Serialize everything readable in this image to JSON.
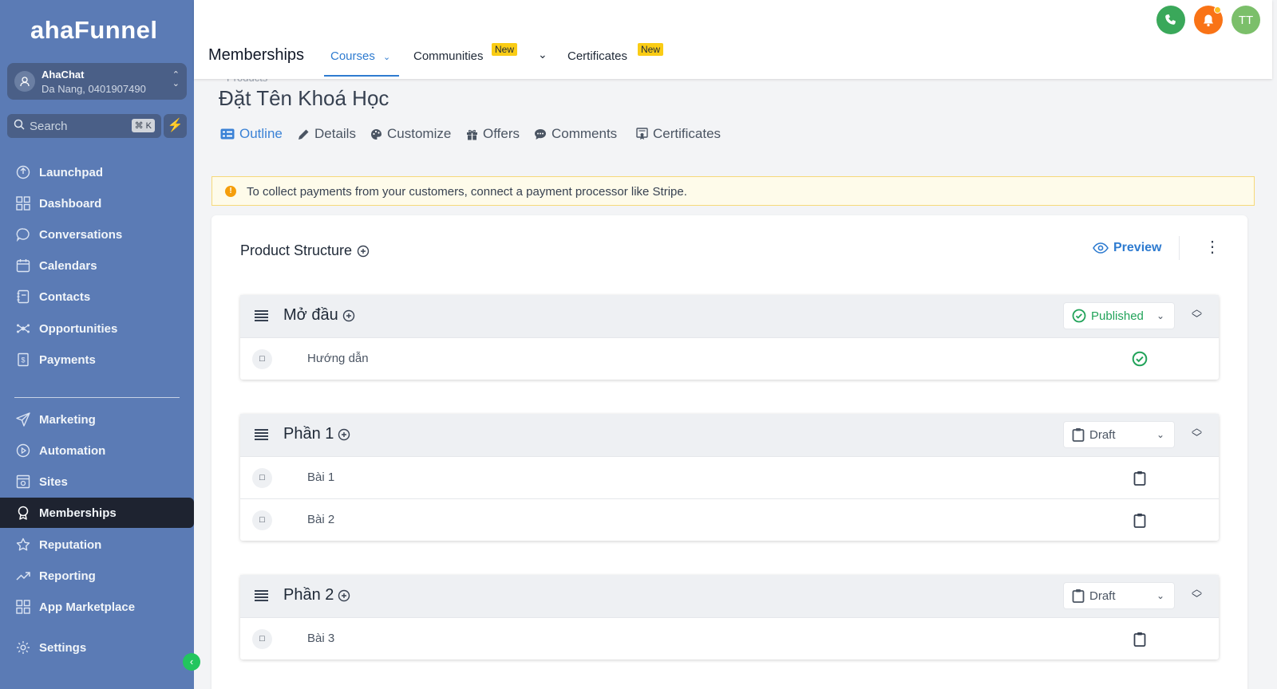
{
  "brand": {
    "logo": "ahaFunnel"
  },
  "account": {
    "name": "AhaChat",
    "location": "Da Nang, 0401907490"
  },
  "search": {
    "placeholder": "Search",
    "shortcut": "⌘ K"
  },
  "sidebar": {
    "items": [
      {
        "label": "Launchpad",
        "icon": "launchpad-icon"
      },
      {
        "label": "Dashboard",
        "icon": "dashboard-icon"
      },
      {
        "label": "Conversations",
        "icon": "chat-icon"
      },
      {
        "label": "Calendars",
        "icon": "calendar-icon"
      },
      {
        "label": "Contacts",
        "icon": "contacts-icon"
      },
      {
        "label": "Opportunities",
        "icon": "opportunities-icon"
      },
      {
        "label": "Payments",
        "icon": "payments-icon"
      },
      {
        "label": "Marketing",
        "icon": "send-icon"
      },
      {
        "label": "Automation",
        "icon": "automation-icon"
      },
      {
        "label": "Sites",
        "icon": "sites-icon"
      },
      {
        "label": "Memberships",
        "icon": "award-icon",
        "active": true
      },
      {
        "label": "Reputation",
        "icon": "star-icon"
      },
      {
        "label": "Reporting",
        "icon": "trend-icon"
      },
      {
        "label": "App Marketplace",
        "icon": "apps-icon"
      },
      {
        "label": "Settings",
        "icon": "gear-icon"
      }
    ]
  },
  "topbar": {
    "title": "Memberships",
    "tabs": [
      {
        "label": "Courses",
        "active": true
      },
      {
        "label": "Communities",
        "badge": "New"
      },
      {
        "label": "Certificates",
        "badge": "New"
      }
    ],
    "avatar_initials": "TT",
    "colors": {
      "phone": "#3aa85a",
      "bell": "#f97316",
      "avatar": "#7bbf6a"
    }
  },
  "course": {
    "breadcrumb": "Products",
    "title": "Đặt Tên Khoá Học",
    "subtabs": [
      "Outline",
      "Details",
      "Customize",
      "Offers",
      "Comments",
      "Certificates"
    ]
  },
  "alert": {
    "text": "To collect payments from your customers, connect a payment processor like Stripe."
  },
  "structure": {
    "title": "Product Structure",
    "preview_label": "Preview",
    "sections": [
      {
        "title": "Mở đầu",
        "status": "Published",
        "lessons": [
          {
            "name": "Hướng dẫn",
            "status": "published"
          }
        ]
      },
      {
        "title": "Phần 1",
        "status": "Draft",
        "lessons": [
          {
            "name": "Bài 1",
            "status": "draft"
          },
          {
            "name": "Bài 2",
            "status": "draft"
          }
        ]
      },
      {
        "title": "Phần 2",
        "status": "Draft",
        "lessons": [
          {
            "name": "Bài 3",
            "status": "draft"
          }
        ]
      }
    ]
  }
}
